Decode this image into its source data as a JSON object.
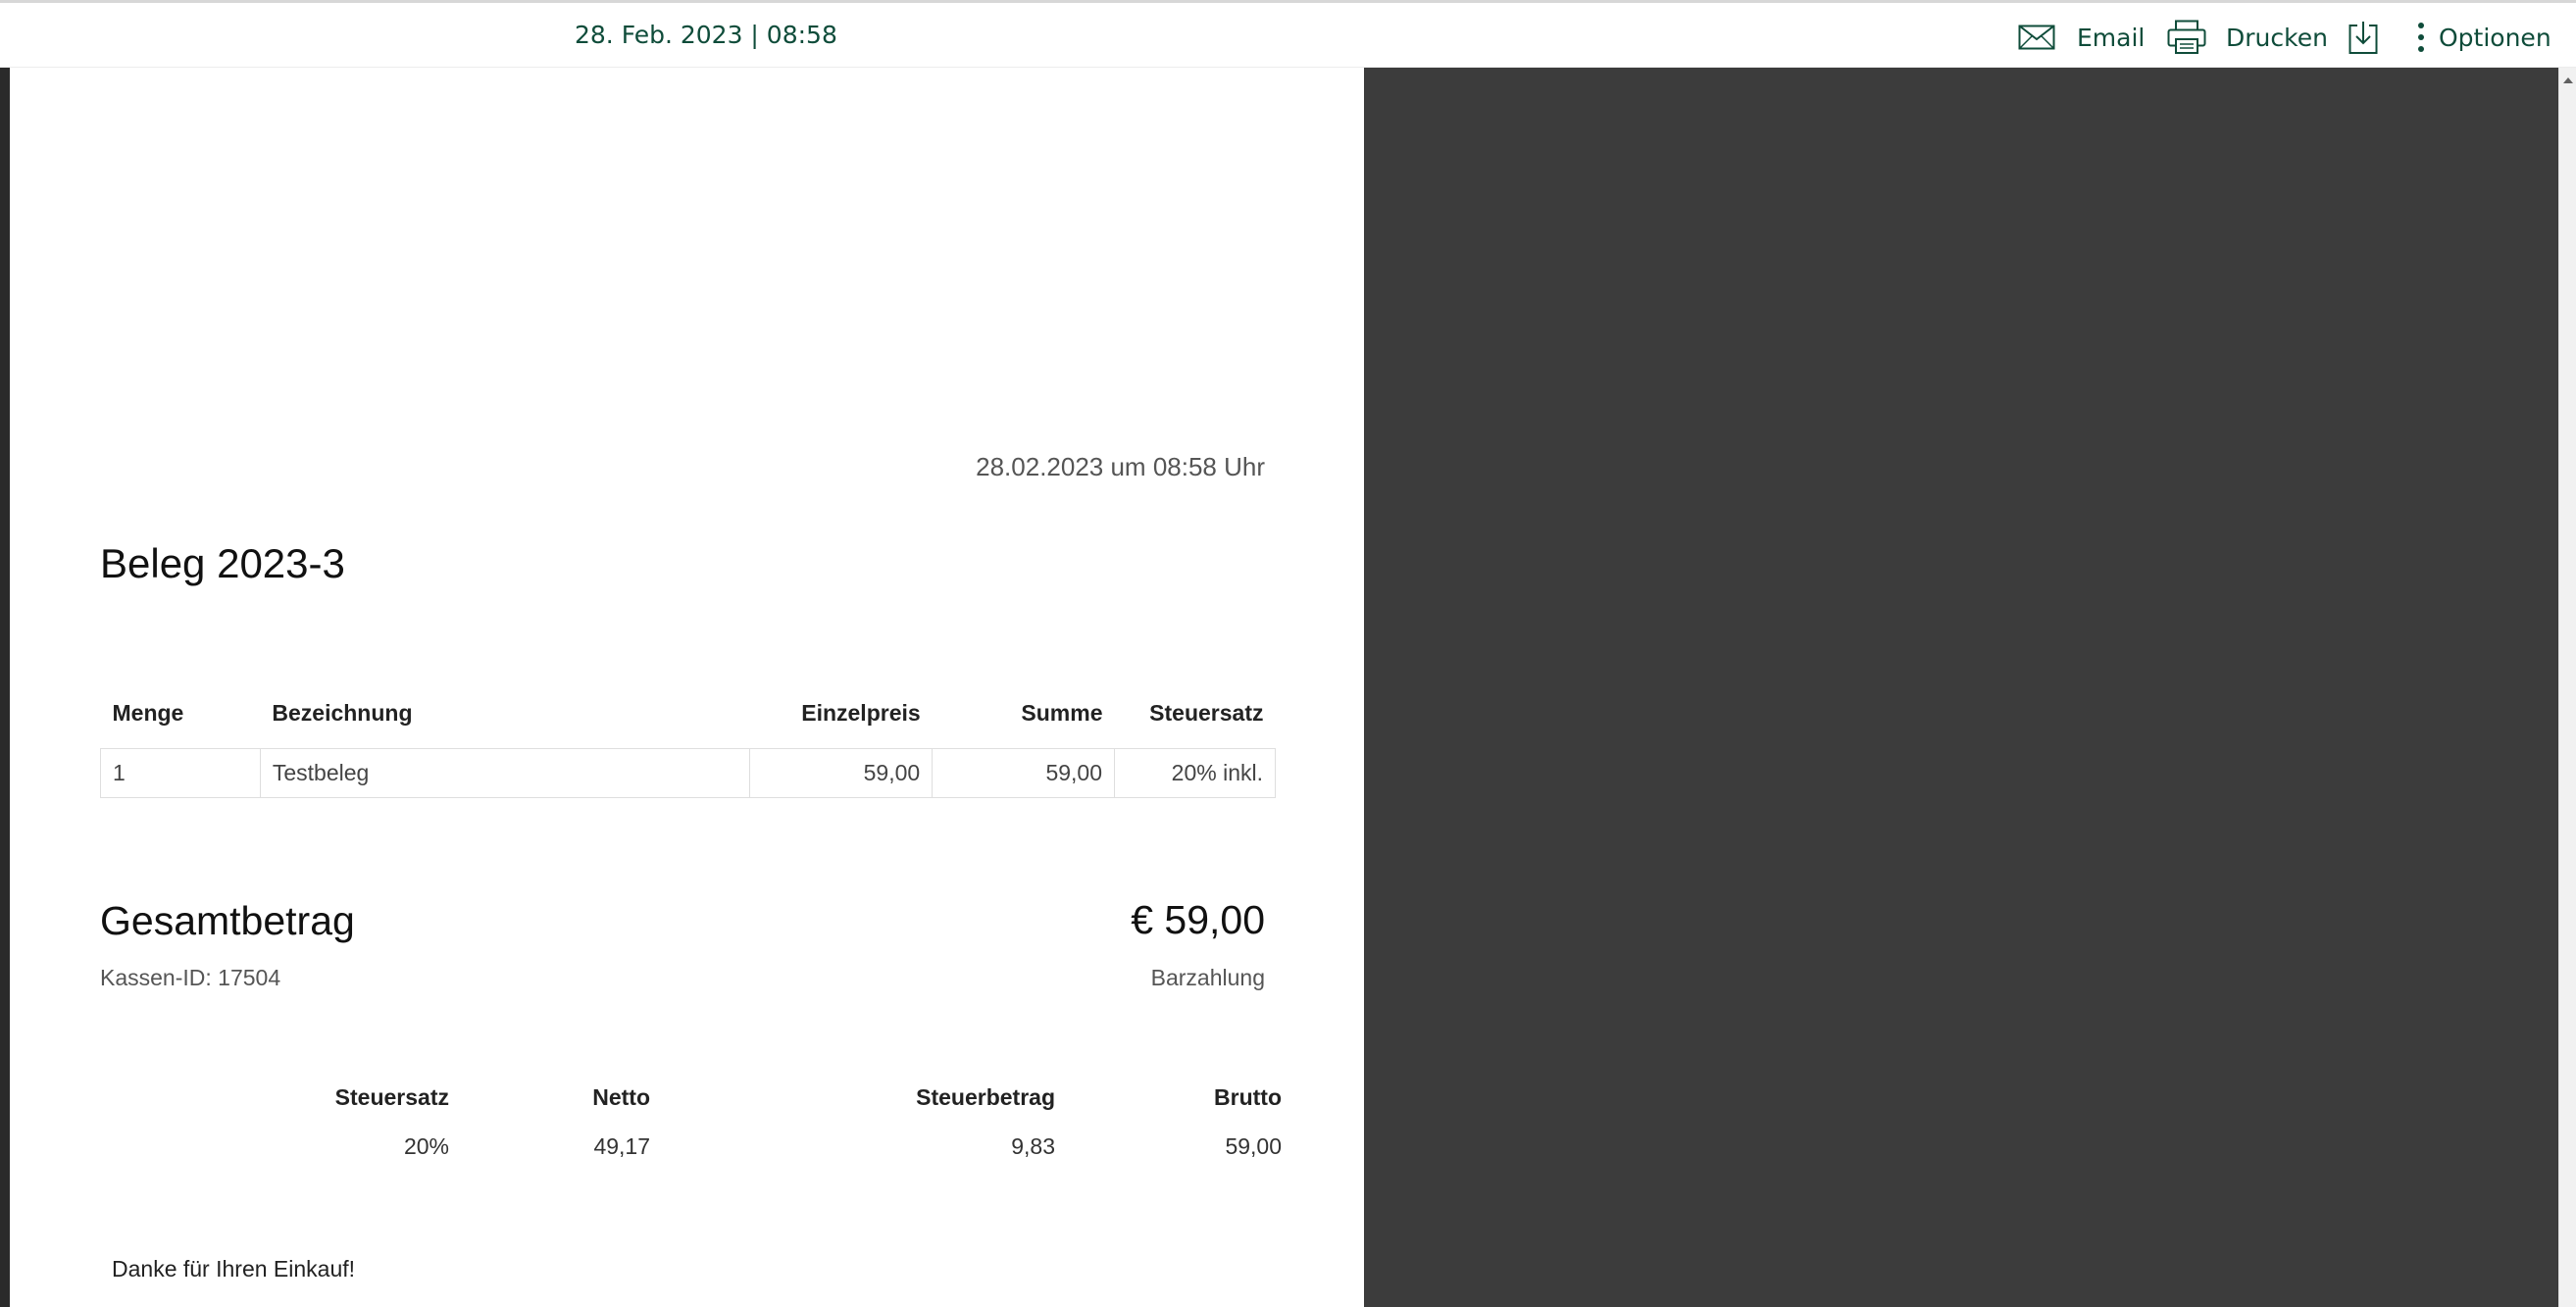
{
  "toolbar": {
    "date": "28. Feb. 2023 | 08:58",
    "email_label": "Email",
    "print_label": "Drucken",
    "options_label": "Optionen",
    "accent_color": "#0f4c3a",
    "icons": [
      "envelope-icon",
      "printer-icon",
      "download-icon",
      "more-vertical-icon"
    ]
  },
  "receipt": {
    "datetime": "28.02.2023 um 08:58 Uhr",
    "title": "Beleg 2023-3",
    "columns": [
      "Menge",
      "Bezeichnung",
      "Einzelpreis",
      "Summe",
      "Steuersatz"
    ],
    "items": [
      {
        "quantity": "1",
        "description": "Testbeleg",
        "unit_price": "59,00",
        "total": "59,00",
        "tax_rate": "20% inkl."
      }
    ],
    "total_label": "Gesamtbetrag",
    "total_value": "€ 59,00",
    "register_id": "Kassen-ID: 17504",
    "payment_method": "Barzahlung",
    "tax_summary": {
      "columns": [
        "Steuersatz",
        "Netto",
        "Steuerbetrag",
        "Brutto"
      ],
      "rows": [
        {
          "rate": "20%",
          "net": "49,17",
          "tax": "9,83",
          "gross": "59,00"
        }
      ]
    },
    "thanks": "Danke für Ihren Einkauf!"
  },
  "colors": {
    "side_panel": "#3c3c3c",
    "left_strip": "#2a2a2a"
  }
}
